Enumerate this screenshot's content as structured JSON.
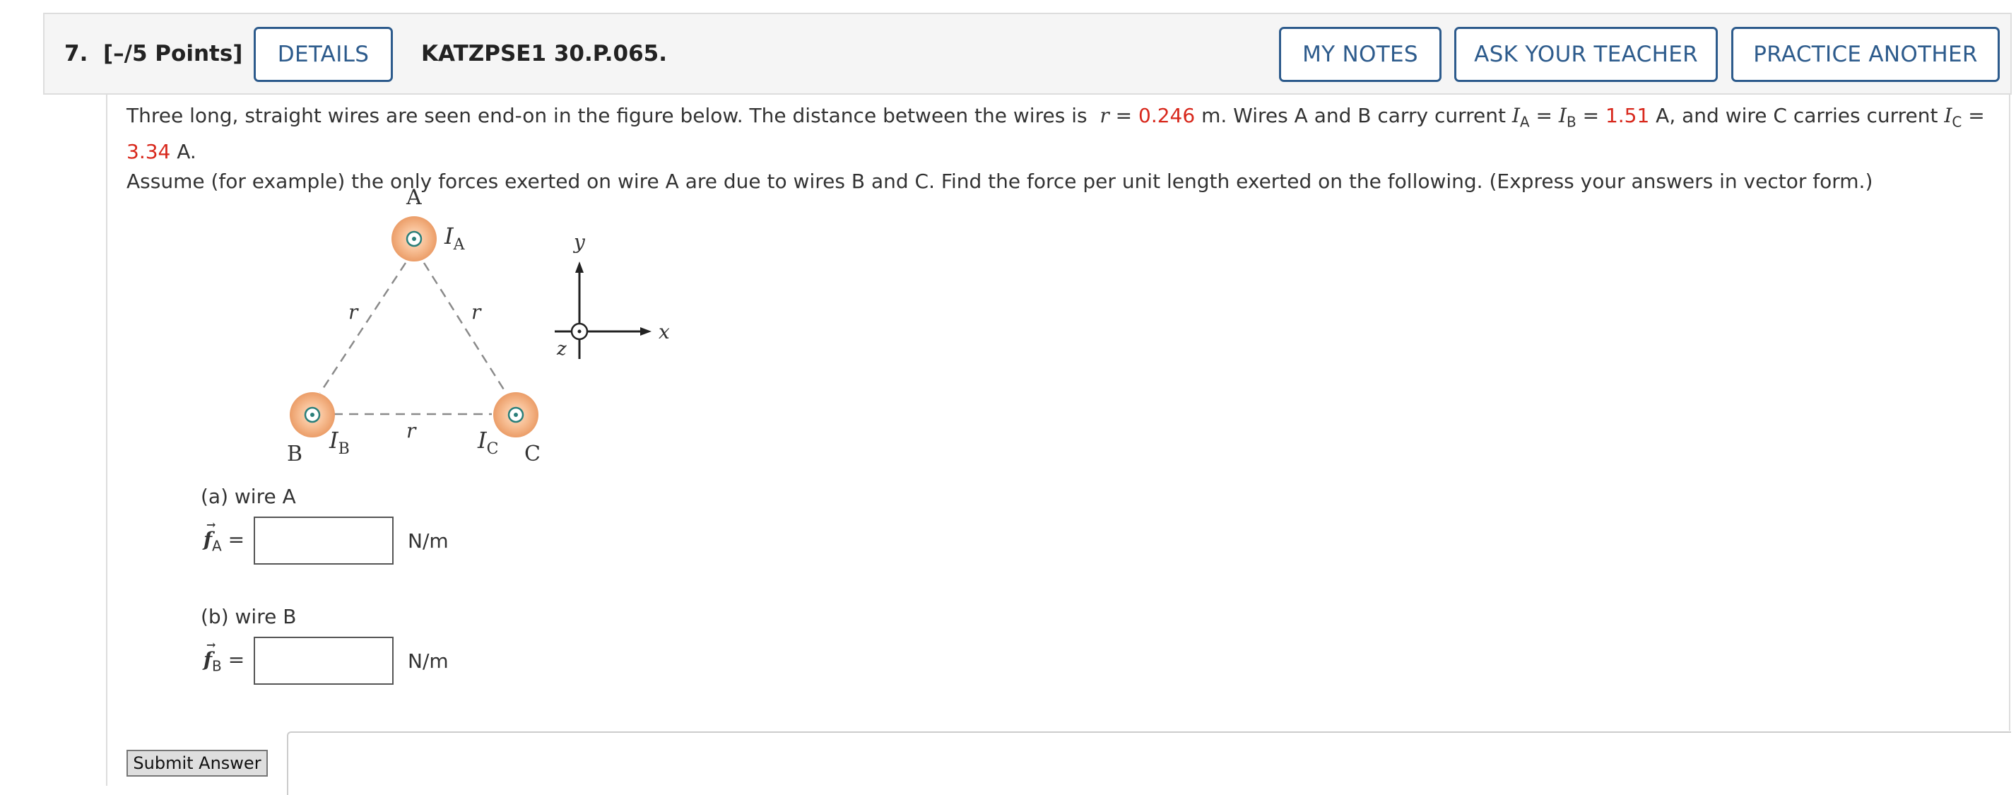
{
  "question": {
    "number": "7.",
    "points": "[–/5 Points]",
    "details_button": "DETAILS",
    "problem_id": "KATZPSE1 30.P.065.",
    "my_notes_button": "MY NOTES",
    "ask_teacher_button": "ASK YOUR TEACHER",
    "practice_button": "PRACTICE ANOTHER"
  },
  "problem": {
    "t1": "Three long, straight wires are seen end-on in the figure below. The distance between the wires is",
    "r_sym": "r",
    "eq1": " = ",
    "r_value": "0.246",
    "t2": " m.  Wires A and B carry current ",
    "ia_sym": "I",
    "ia_sub": "A",
    "eq2": " = ",
    "ib_sym": "I",
    "ib_sub": "B",
    "eq3": " = ",
    "iab_value": "1.51",
    "t3": " A,  and wire C carries current ",
    "ic_sym": "I",
    "ic_sub": "C",
    "eq4": " = ",
    "ic_value": "3.34",
    "t4": " A.",
    "t5": "Assume (for example) the only forces exerted on wire A are due to wires B and C. Find the force per unit length exerted on the following. (Express your answers in vector form.)"
  },
  "figure": {
    "label_a": "A",
    "label_b": "B",
    "label_c": "C",
    "current_a": "I",
    "current_a_sub": "A",
    "current_b": "I",
    "current_b_sub": "B",
    "current_c": "I",
    "current_c_sub": "C",
    "r_ab": "r",
    "r_ac": "r",
    "r_bc": "r",
    "axis_x": "x",
    "axis_y": "y",
    "axis_z": "z"
  },
  "parts": [
    {
      "label": "(a) wire A",
      "symbol": "f",
      "sub": "A",
      "equals": "=",
      "value": "",
      "unit": "N/m"
    },
    {
      "label": "(b) wire B",
      "symbol": "f",
      "sub": "B",
      "equals": "=",
      "value": "",
      "unit": "N/m"
    }
  ],
  "submit_label": "Submit Answer",
  "colors": {
    "button_blue": "#2d5b8c",
    "value_red": "#d8281c",
    "wire_orange": "#f4b084",
    "wire_dot_teal": "#2a7f7a"
  },
  "icons": {
    "wire_symbol": "current-out-of-page-icon",
    "vector_arrow": "vector-arrow-icon"
  }
}
